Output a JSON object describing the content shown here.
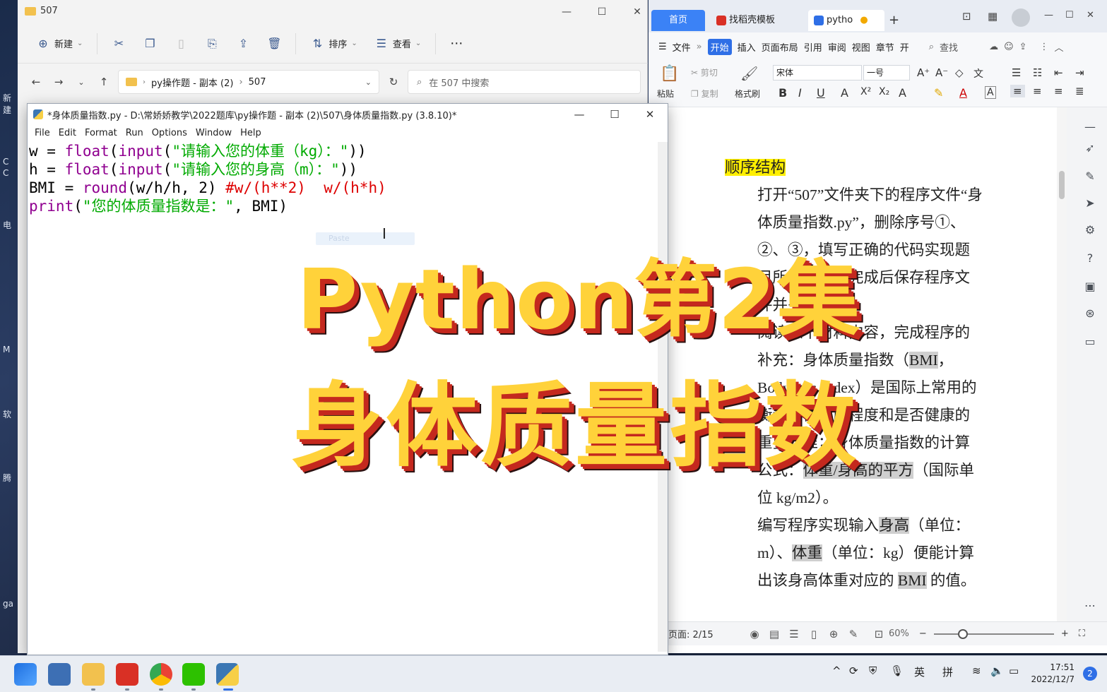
{
  "desktop": {
    "labels": [
      "新建",
      "C",
      "C",
      "电",
      "M",
      "软",
      "腾",
      "ga"
    ]
  },
  "explorer": {
    "title": "507",
    "toolbar": {
      "new_label": "新建",
      "sort_label": "排序",
      "view_label": "查看",
      "more_label": "⋯"
    },
    "breadcrumb": [
      "py操作题 - 副本 (2)",
      "507"
    ],
    "search_placeholder": "在 507 中搜索"
  },
  "idle": {
    "title": "*身体质量指数.py - D:\\常娇娇教学\\2022题库\\py操作题 - 副本 (2)\\507\\身体质量指数.py (3.8.10)*",
    "menu": [
      "File",
      "Edit",
      "Format",
      "Run",
      "Options",
      "Window",
      "Help"
    ],
    "code": {
      "line1": {
        "a": "w = ",
        "b": "float",
        "c": "(",
        "d": "input",
        "e": "(",
        "f": "\"请输入您的体重（kg）：\"",
        "g": "))"
      },
      "line2": {
        "a": "h = ",
        "b": "float",
        "c": "(",
        "d": "input",
        "e": "(",
        "f": "\"请输入您的身高（m）：\"",
        "g": "))"
      },
      "line3": {
        "a": "BMI = ",
        "b": "round",
        "c": "(w/h/h, 2) ",
        "d": "#w/(h**2)  w/(h*h)"
      },
      "line4": {
        "a": "print",
        "b": "(",
        "c": "\"您的体质量指数是：\"",
        "d": ", BMI)"
      }
    },
    "ghost_tip": "Paste"
  },
  "wps": {
    "tabs": {
      "home": "首页",
      "tab1": "找稻壳模板",
      "tab2": "pytho"
    },
    "menu": [
      "文件",
      "开始",
      "插入",
      "页面布局",
      "引用",
      "审阅",
      "视图",
      "章节",
      "开"
    ],
    "search_label": "查找",
    "ribbon": {
      "paste": "粘贴",
      "cut": "剪切",
      "copy": "复制",
      "format_painter": "格式刷",
      "font_name": "宋体",
      "font_size": "一号"
    },
    "document": {
      "heading": "顺序结构",
      "p1_before": "打开“507”文件夹下的程序文件“身体质量指数.py”，删除序号①、②、③，填写正确的代码实现题目所述功能，完成后保存程序文件并关闭。",
      "p2_a": "阅读以下材料内容，完成程序的补充：身体质量指数（",
      "p2_bmi": "BMI",
      "p2_b": "，Body lass Index）是国际上常用的衡量人体肥胖程度和是否健康的重要标准；身体质量指数的计算公式：",
      "p2_formula": "体重/身高的平方",
      "p2_c": "（国际单位 kg/m2）。",
      "p3_a": "编写程序实现输入",
      "p3_h": "身高",
      "p3_b": "（单位：m）、",
      "p3_w": "体重",
      "p3_c": "（单位：kg）便能计算出该身高体重对应的 ",
      "p3_bmi": "BMI",
      "p3_d": " 的值。"
    },
    "status": {
      "page": "页面: 2/15",
      "zoom": "60%"
    }
  },
  "overlay": {
    "line1": "Python第2集",
    "line2": "身体质量指数"
  },
  "taskbar": {
    "ime1": "英",
    "ime2": "拼",
    "time": "17:51",
    "date": "2022/12/7",
    "badge": "2"
  }
}
